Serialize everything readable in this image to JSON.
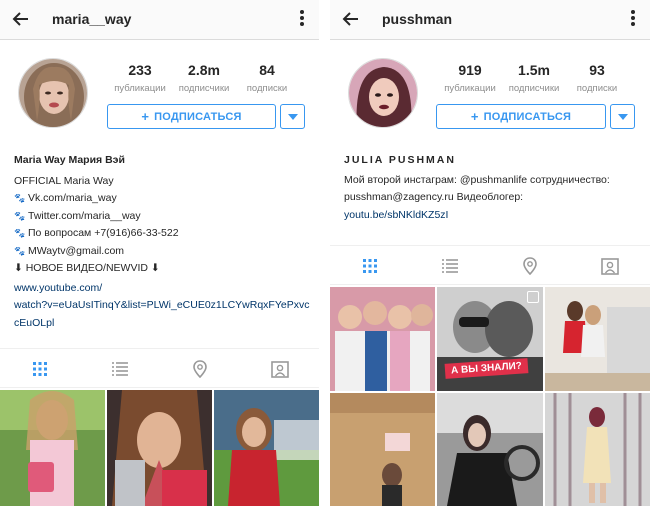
{
  "left": {
    "username": "maria__way",
    "stats": [
      {
        "num": "233",
        "label": "публикации"
      },
      {
        "num": "2.8m",
        "label": "подписчики"
      },
      {
        "num": "84",
        "label": "подписки"
      }
    ],
    "follow_label": "ПОДПИСАТЬСЯ",
    "bio": {
      "name": "Maria Way Мария Вэй",
      "line1": "OFFICIAL Maria Way",
      "line2": "Vk.com/maria_way",
      "line3": "Twitter.com/maria__way",
      "line4": "По вопросам +7(916)66-33-522",
      "line5": "MWaytv@gmail.com",
      "line6": "⬇ НОВОЕ ВИДЕО/NEWVID ⬇",
      "link1": "www.youtube.com/",
      "link2": "watch?v=eUaUsITinqY&list=PLWi_eCUE0z1LCYwRqxFYePxvc",
      "link3": "cEuOLpl"
    }
  },
  "right": {
    "username": "pusshman",
    "stats": [
      {
        "num": "919",
        "label": "публикации"
      },
      {
        "num": "1.5m",
        "label": "подписчики"
      },
      {
        "num": "93",
        "label": "подписки"
      }
    ],
    "follow_label": "ПОДПИСАТЬСЯ",
    "bio": {
      "name": "JULIA PUSHMAN",
      "line1": "Мой второй инстаграм: @pushmanlife сотрудничество:",
      "line2": "pusshman@zagency.ru Видеоблогер:",
      "link1": "youtu.be/sbNKldKZ5zI"
    },
    "photo_overlay_text": "А ВЫ ЗНАЛИ?"
  },
  "colors": {
    "accent": "#3897f0",
    "link": "#003569",
    "muted": "#8e8e8e"
  },
  "icons": {
    "back": "arrow-left-icon",
    "more": "more-vertical-icon",
    "grid": "grid-icon",
    "list": "list-icon",
    "location": "location-pin-icon",
    "tagged": "tagged-person-icon"
  }
}
